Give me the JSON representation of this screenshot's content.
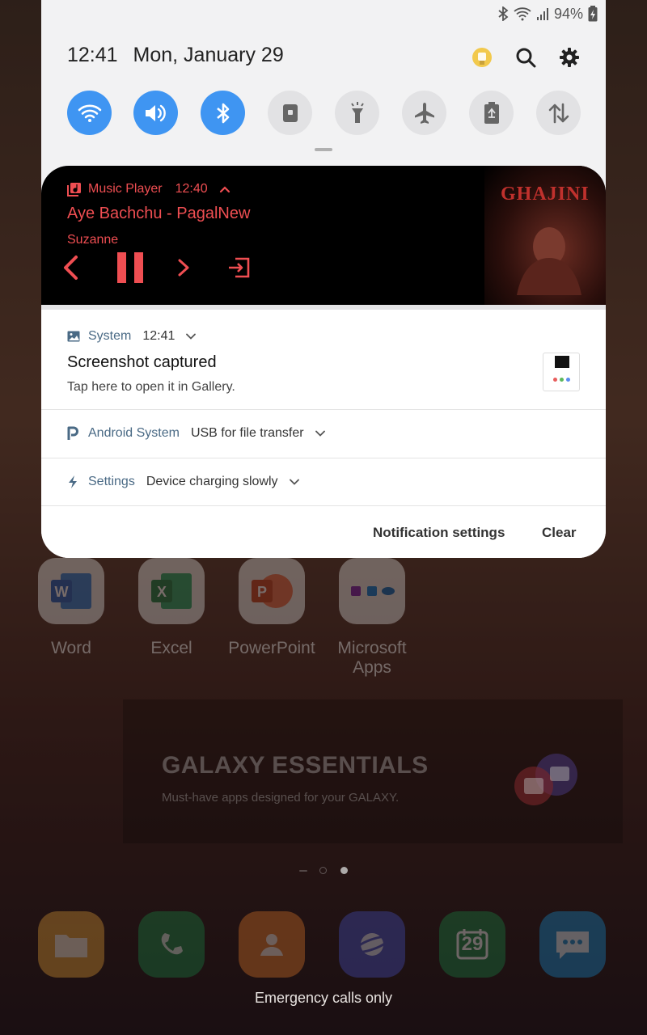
{
  "status_bar": {
    "battery": "94%"
  },
  "header": {
    "time": "12:41",
    "date": "Mon, January 29"
  },
  "quick_settings": [
    {
      "name": "Wi-Fi",
      "state": "on"
    },
    {
      "name": "Sound",
      "state": "on"
    },
    {
      "name": "Bluetooth",
      "state": "on"
    },
    {
      "name": "Screen lock",
      "state": "off"
    },
    {
      "name": "Flashlight",
      "state": "off"
    },
    {
      "name": "Airplane mode",
      "state": "off"
    },
    {
      "name": "Power saving",
      "state": "off"
    },
    {
      "name": "Mobile data",
      "state": "off"
    }
  ],
  "media": {
    "app": "Music Player",
    "time": "12:40",
    "title": "Aye Bachchu - PagalNew",
    "artist": "Suzanne",
    "album_art_text": "GHAJINI",
    "accent_color": "#ef4e52"
  },
  "notifications": {
    "system": {
      "app": "System",
      "time": "12:41",
      "title": "Screenshot captured",
      "text": "Tap here to open it in Gallery."
    },
    "usb": {
      "app": "Android System",
      "text": "USB for file transfer"
    },
    "charging": {
      "app": "Settings",
      "text": "Device charging slowly"
    }
  },
  "footer": {
    "notification_settings": "Notification settings",
    "clear": "Clear"
  },
  "home": {
    "apps": [
      "Word",
      "Excel",
      "PowerPoint",
      "Microsoft Apps"
    ],
    "banner_title": "GALAXY ESSENTIALS",
    "banner_subtitle": "Must-have apps designed for your GALAXY.",
    "calendar_day": "29",
    "emergency": "Emergency calls only"
  },
  "colors": {
    "qs_on": "#3f95f2",
    "qs_off": "#e2e2e4",
    "panel_bg": "#f2f2f3"
  }
}
